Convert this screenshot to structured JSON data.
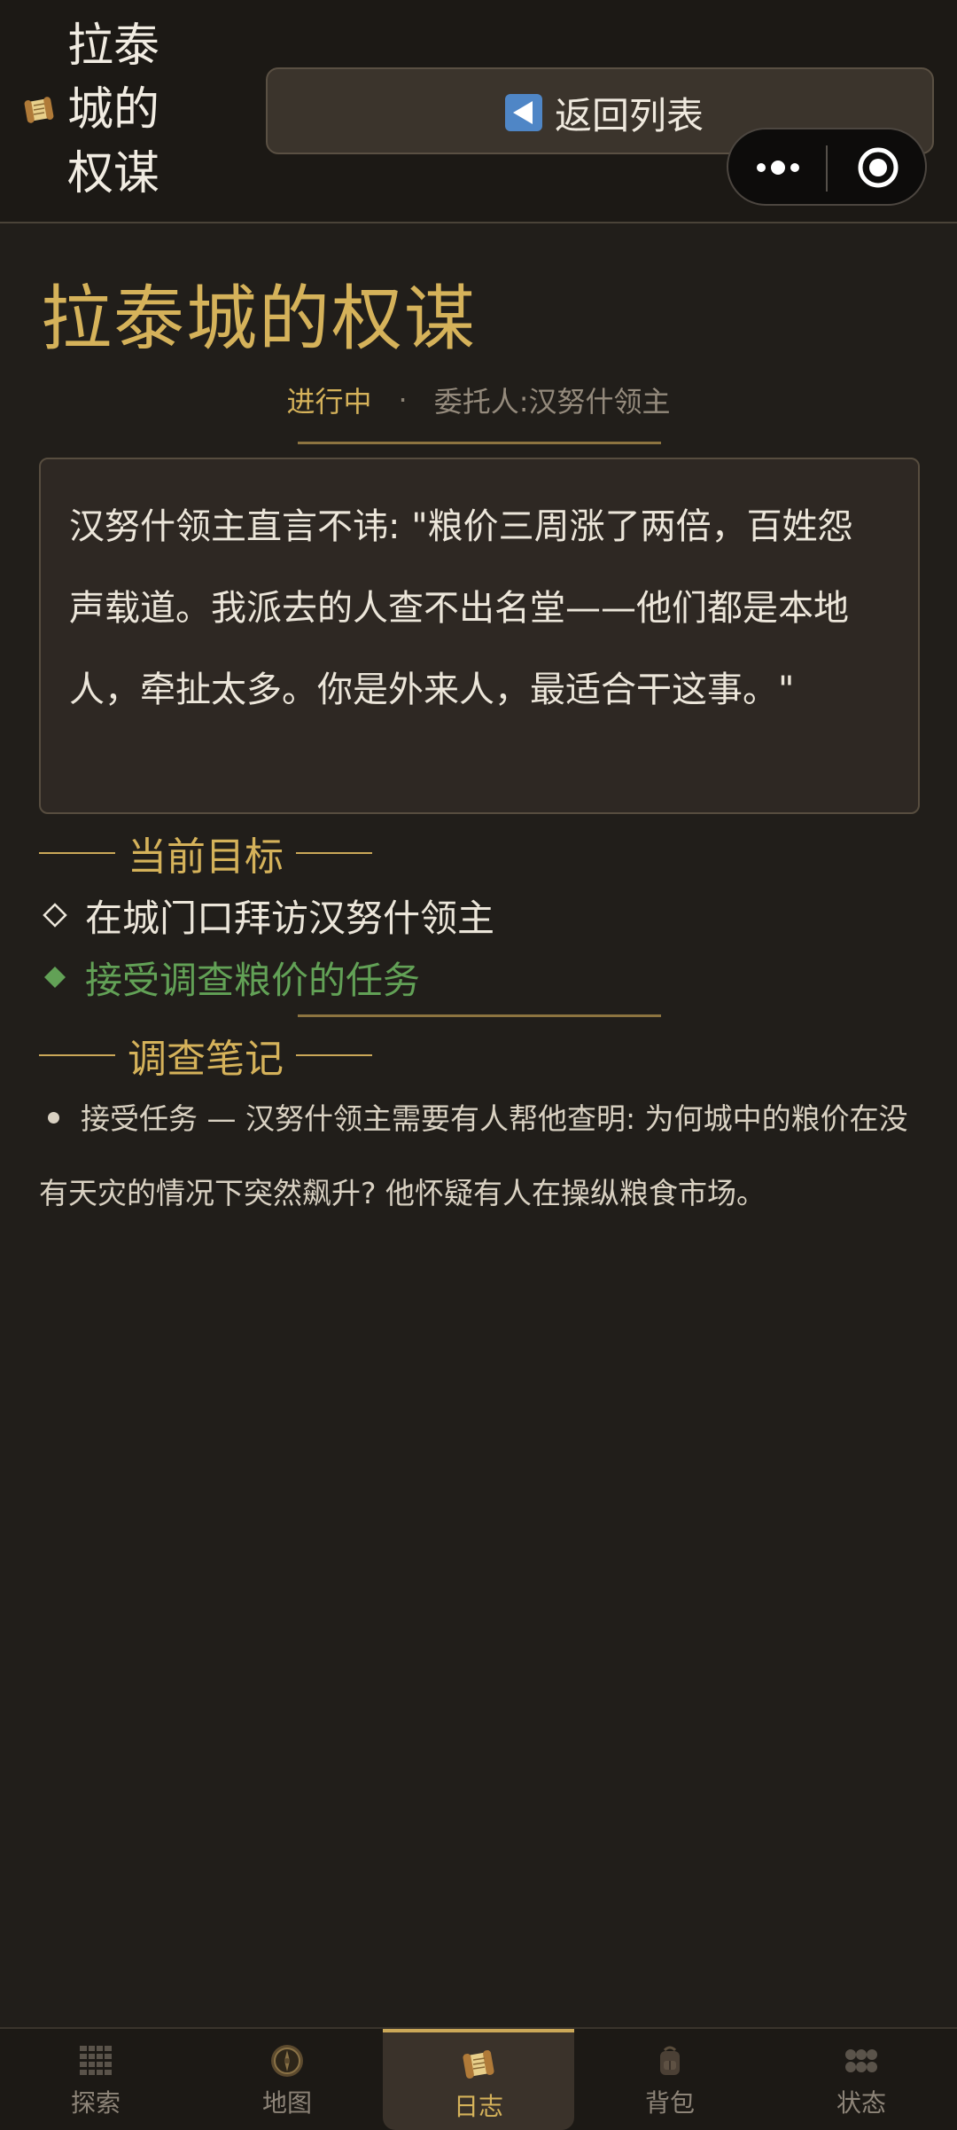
{
  "header": {
    "title": "拉泰城的权谋",
    "back_label": "返回列表"
  },
  "quest": {
    "title": "拉泰城的权谋",
    "status": "进行中",
    "separator": "·",
    "client_label": "委托人:",
    "client_name": "汉努什领主",
    "description": "汉努什领主直言不讳: \"粮价三周涨了两倍，百姓怨声载道。我派去的人查不出名堂——他们都是本地人，牵扯太多。你是外来人，最适合干这事。\""
  },
  "objectives": {
    "header": "当前目标",
    "items": [
      {
        "text": "在城门口拜访汉努什领主",
        "state": "pending"
      },
      {
        "text": "接受调查粮价的任务",
        "state": "active"
      }
    ]
  },
  "notes": {
    "header": "调查笔记",
    "items": [
      {
        "text": "接受任务 — 汉努什领主需要有人帮他查明: 为何城中的粮价在没有天灾的情况下突然飙升? 他怀疑有人在操纵粮食市场。"
      }
    ]
  },
  "nav": {
    "items": [
      {
        "label": "探索",
        "icon": "explore-grid-icon"
      },
      {
        "label": "地图",
        "icon": "compass-map-icon"
      },
      {
        "label": "日志",
        "icon": "scroll-journal-icon",
        "active": true
      },
      {
        "label": "背包",
        "icon": "backpack-icon"
      },
      {
        "label": "状态",
        "icon": "status-orbs-icon"
      }
    ]
  },
  "colors": {
    "background": "#211e1a",
    "gold": "#d5b25a",
    "active_green": "#62a156",
    "back_icon": "#4f86c6"
  }
}
